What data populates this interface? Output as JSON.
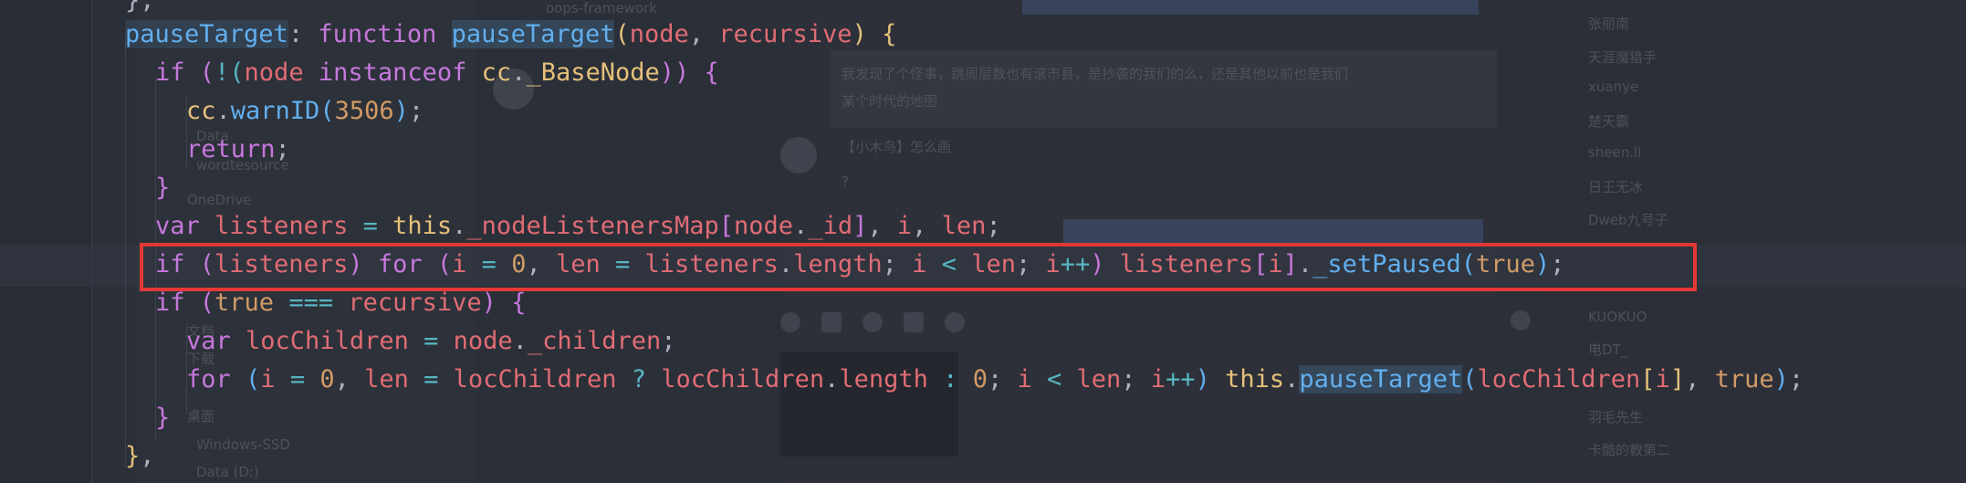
{
  "editor": {
    "lines": [
      {
        "tokens": [
          {
            "t": "};",
            "c": "plain"
          }
        ]
      },
      {
        "tokens": [
          {
            "t": "pauseTarget",
            "c": "prop"
          },
          {
            "t": ": ",
            "c": "plain"
          },
          {
            "t": "function",
            "c": "kw"
          },
          {
            "t": " ",
            "c": "plain"
          },
          {
            "t": "pauseTarget",
            "c": "fnbox"
          },
          {
            "t": "(",
            "c": "brace"
          },
          {
            "t": "node",
            "c": "param"
          },
          {
            "t": ", ",
            "c": "plain"
          },
          {
            "t": "recursive",
            "c": "param"
          },
          {
            "t": ")",
            "c": "brace"
          },
          {
            "t": " {",
            "c": "brace"
          }
        ]
      },
      {
        "tokens": [
          {
            "t": "if",
            "c": "kw"
          },
          {
            "t": " (",
            "c": "brace2"
          },
          {
            "t": "!(",
            "c": "op"
          },
          {
            "t": "node",
            "c": "param"
          },
          {
            "t": " instanceof ",
            "c": "kw"
          },
          {
            "t": "cc",
            "c": "cls"
          },
          {
            "t": ".",
            "c": "plain"
          },
          {
            "t": "_BaseNode",
            "c": "cls"
          },
          {
            "t": "))",
            "c": "brace2"
          },
          {
            "t": " {",
            "c": "brace2"
          }
        ]
      },
      {
        "tokens": [
          {
            "t": "cc",
            "c": "cls"
          },
          {
            "t": ".",
            "c": "plain"
          },
          {
            "t": "warnID",
            "c": "fn"
          },
          {
            "t": "(",
            "c": "brace3"
          },
          {
            "t": "3506",
            "c": "num"
          },
          {
            "t": ")",
            "c": "brace3"
          },
          {
            "t": ";",
            "c": "plain"
          }
        ]
      },
      {
        "tokens": [
          {
            "t": "return",
            "c": "kw"
          },
          {
            "t": ";",
            "c": "plain"
          }
        ]
      },
      {
        "tokens": [
          {
            "t": "}",
            "c": "brace2"
          }
        ]
      },
      {
        "tokens": [
          {
            "t": "var",
            "c": "kw"
          },
          {
            "t": " listeners ",
            "c": "mem"
          },
          {
            "t": "=",
            "c": "op"
          },
          {
            "t": " ",
            "c": "plain"
          },
          {
            "t": "this",
            "c": "this"
          },
          {
            "t": ".",
            "c": "plain"
          },
          {
            "t": "_nodeListenersMap",
            "c": "mem"
          },
          {
            "t": "[",
            "c": "brace2"
          },
          {
            "t": "node",
            "c": "param"
          },
          {
            "t": ".",
            "c": "plain"
          },
          {
            "t": "_id",
            "c": "mem"
          },
          {
            "t": "]",
            "c": "brace2"
          },
          {
            "t": ", ",
            "c": "plain"
          },
          {
            "t": "i",
            "c": "mem"
          },
          {
            "t": ", ",
            "c": "plain"
          },
          {
            "t": "len",
            "c": "mem"
          },
          {
            "t": ";",
            "c": "plain"
          }
        ]
      },
      {
        "tokens": [
          {
            "t": "if",
            "c": "kw"
          },
          {
            "t": " (",
            "c": "brace2"
          },
          {
            "t": "listeners",
            "c": "mem"
          },
          {
            "t": ")",
            "c": "brace2"
          },
          {
            "t": " for ",
            "c": "kw"
          },
          {
            "t": "(",
            "c": "brace2"
          },
          {
            "t": "i ",
            "c": "mem"
          },
          {
            "t": "=",
            "c": "op"
          },
          {
            "t": " ",
            "c": "plain"
          },
          {
            "t": "0",
            "c": "num"
          },
          {
            "t": ", ",
            "c": "plain"
          },
          {
            "t": "len ",
            "c": "mem"
          },
          {
            "t": "=",
            "c": "op"
          },
          {
            "t": " listeners",
            "c": "mem"
          },
          {
            "t": ".",
            "c": "plain"
          },
          {
            "t": "length",
            "c": "mem"
          },
          {
            "t": "; ",
            "c": "plain"
          },
          {
            "t": "i ",
            "c": "mem"
          },
          {
            "t": "<",
            "c": "op"
          },
          {
            "t": " len",
            "c": "mem"
          },
          {
            "t": "; ",
            "c": "plain"
          },
          {
            "t": "i",
            "c": "mem"
          },
          {
            "t": "++",
            "c": "op"
          },
          {
            "t": ")",
            "c": "brace2"
          },
          {
            "t": " listeners",
            "c": "mem"
          },
          {
            "t": "[",
            "c": "brace2"
          },
          {
            "t": "i",
            "c": "mem"
          },
          {
            "t": "]",
            "c": "brace2"
          },
          {
            "t": ".",
            "c": "plain"
          },
          {
            "t": "_setPaused",
            "c": "fn"
          },
          {
            "t": "(",
            "c": "brace3"
          },
          {
            "t": "true",
            "c": "bool"
          },
          {
            "t": ")",
            "c": "brace3"
          },
          {
            "t": ";",
            "c": "plain"
          }
        ]
      },
      {
        "tokens": [
          {
            "t": "if",
            "c": "kw"
          },
          {
            "t": " (",
            "c": "brace2"
          },
          {
            "t": "true",
            "c": "bool"
          },
          {
            "t": " ",
            "c": "plain"
          },
          {
            "t": "===",
            "c": "op"
          },
          {
            "t": " recursive",
            "c": "param"
          },
          {
            "t": ")",
            "c": "brace2"
          },
          {
            "t": " {",
            "c": "brace2"
          }
        ]
      },
      {
        "tokens": [
          {
            "t": "var",
            "c": "kw"
          },
          {
            "t": " locChildren ",
            "c": "mem"
          },
          {
            "t": "=",
            "c": "op"
          },
          {
            "t": " node",
            "c": "param"
          },
          {
            "t": ".",
            "c": "plain"
          },
          {
            "t": "_children",
            "c": "mem"
          },
          {
            "t": ";",
            "c": "plain"
          }
        ]
      },
      {
        "tokens": [
          {
            "t": "for",
            "c": "kw"
          },
          {
            "t": " (",
            "c": "brace3"
          },
          {
            "t": "i ",
            "c": "mem"
          },
          {
            "t": "=",
            "c": "op"
          },
          {
            "t": " ",
            "c": "plain"
          },
          {
            "t": "0",
            "c": "num"
          },
          {
            "t": ", ",
            "c": "plain"
          },
          {
            "t": "len ",
            "c": "mem"
          },
          {
            "t": "=",
            "c": "op"
          },
          {
            "t": " locChildren ",
            "c": "mem"
          },
          {
            "t": "?",
            "c": "op"
          },
          {
            "t": " locChildren",
            "c": "mem"
          },
          {
            "t": ".",
            "c": "plain"
          },
          {
            "t": "length ",
            "c": "mem"
          },
          {
            "t": ":",
            "c": "op"
          },
          {
            "t": " ",
            "c": "plain"
          },
          {
            "t": "0",
            "c": "num"
          },
          {
            "t": "; ",
            "c": "plain"
          },
          {
            "t": "i ",
            "c": "mem"
          },
          {
            "t": "<",
            "c": "op"
          },
          {
            "t": " len",
            "c": "mem"
          },
          {
            "t": "; ",
            "c": "plain"
          },
          {
            "t": "i",
            "c": "mem"
          },
          {
            "t": "++",
            "c": "op"
          },
          {
            "t": ")",
            "c": "brace3"
          },
          {
            "t": " ",
            "c": "plain"
          },
          {
            "t": "this",
            "c": "this"
          },
          {
            "t": ".",
            "c": "plain"
          },
          {
            "t": "pauseTarget",
            "c": "fnbox"
          },
          {
            "t": "(",
            "c": "brace3"
          },
          {
            "t": "locChildren",
            "c": "mem"
          },
          {
            "t": "[",
            "c": "brace"
          },
          {
            "t": "i",
            "c": "mem"
          },
          {
            "t": "]",
            "c": "brace"
          },
          {
            "t": ", ",
            "c": "plain"
          },
          {
            "t": "true",
            "c": "bool"
          },
          {
            "t": ")",
            "c": "brace3"
          },
          {
            "t": ";",
            "c": "plain"
          }
        ]
      },
      {
        "tokens": [
          {
            "t": "}",
            "c": "brace2"
          }
        ]
      },
      {
        "tokens": [
          {
            "t": "}",
            "c": "brace"
          },
          {
            "t": ",",
            "c": "plain"
          }
        ]
      }
    ]
  },
  "background": {
    "left_texts": [
      "Data",
      "wordtesource",
      "OneDrive",
      "文档",
      "下载",
      "桌面",
      "Windows-SSD",
      "Data (D:)"
    ],
    "chat_texts": [
      "oops-framework",
      "我发现了个怪事，跳周层数也有滚市县，是抄袭的我们的么，还是其他以前也是我们",
      "某个时代的地图",
      "【小木鸟】怎么画",
      "?"
    ],
    "right_texts": [
      "张丽南",
      "天涯魔猎手",
      "xuanye",
      "楚天霸",
      "sheen.li",
      "日王无冰",
      "Dweb九号子",
      "KUOKUO",
      "电DT_",
      "羽毛先生",
      "卡酷的教第二"
    ]
  }
}
